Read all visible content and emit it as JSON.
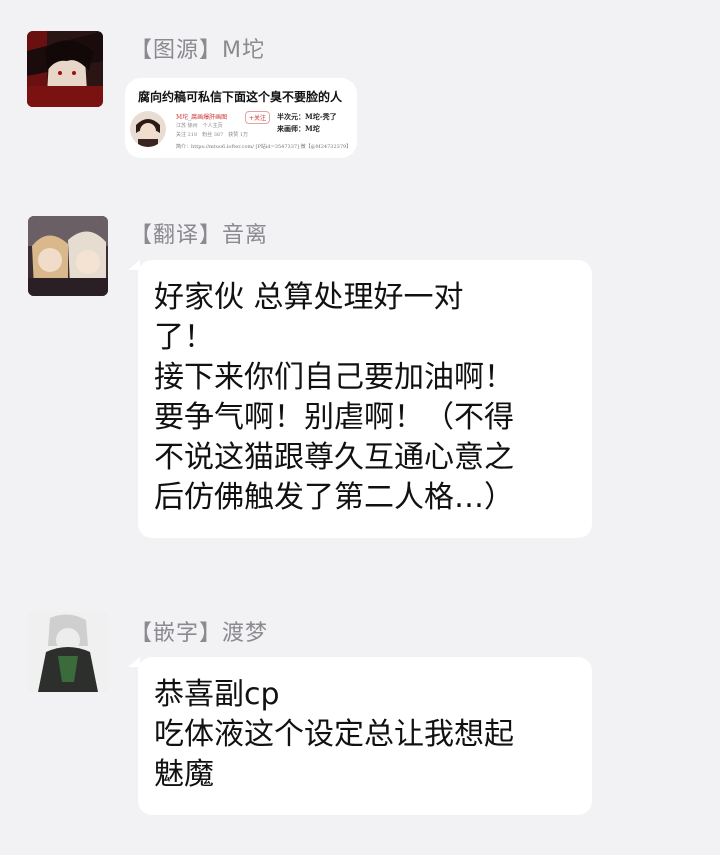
{
  "messages": [
    {
      "sender": "【图源】M坨",
      "avatar": "dark-haired-character-avatar",
      "card": {
        "title": "腐向约稿可私信下面这个臭不要脸的人",
        "name": "M坨_腐画爆肝画图",
        "follow": "+关注",
        "location": "江苏 徐州　个人主页",
        "stats": "关注 218　粉丝 387　获赞 1万",
        "right_line1": "半次元：M坨-秃了",
        "right_line2": "来画师：M坨",
        "bio": "简介：https://mtuo6.lofter.com/ [P站id=3547337] 微【@M24732379】"
      }
    },
    {
      "sender": "【翻译】音离",
      "avatar": "blond-characters-avatar",
      "lines": [
        "好家伙  总算处理好一对",
        "了！",
        "接下来你们自己要加油啊！",
        "要争气啊！别虐啊！（不得",
        "不说这猫跟尊久互通心意之",
        "后仿佛触发了第二人格…）"
      ]
    },
    {
      "sender": "【嵌字】渡梦",
      "avatar": "silver-haired-character-avatar",
      "lines": [
        "恭喜副cp",
        "吃体液这个设定总让我想起",
        "魅魔"
      ]
    }
  ]
}
